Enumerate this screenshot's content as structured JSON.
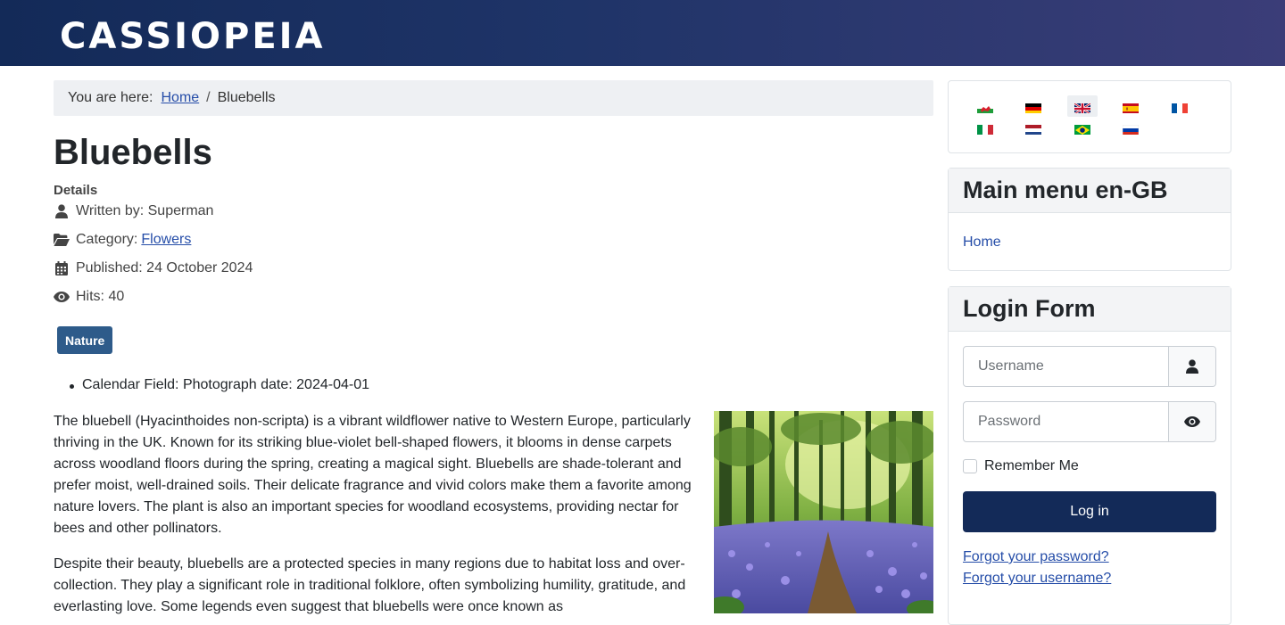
{
  "header": {
    "brand": "CASSIOPEIA"
  },
  "breadcrumb": {
    "prefix": "You are here:",
    "home": "Home",
    "separator": "/",
    "current": "Bluebells"
  },
  "article": {
    "title": "Bluebells",
    "details_label": "Details",
    "author": "Written by: Superman",
    "category_label": "Category:",
    "category_link": "Flowers",
    "published": "Published: 24 October 2024",
    "hits": "Hits: 40",
    "tag": "Nature",
    "custom_field": "Calendar Field: Photograph date: 2024-04-01",
    "paragraph1": "The bluebell (Hyacinthoides non-scripta) is a vibrant wildflower native to Western Europe, particularly thriving in the UK. Known for its striking blue-violet bell-shaped flowers, it blooms in dense carpets across woodland floors during the spring, creating a magical sight. Bluebells are shade-tolerant and prefer moist, well-drained soils. Their delicate fragrance and vivid colors make them a favorite among nature lovers. The plant is also an important species for woodland ecosystems, providing nectar for bees and other pollinators.",
    "paragraph2": "Despite their beauty, bluebells are a protected species in many regions due to habitat loss and over-collection. They play a significant role in traditional folklore, often symbolizing humility, gratitude, and everlasting love. Some legends even suggest that bluebells were once known as"
  },
  "languages": [
    {
      "name": "Welsh",
      "active": false
    },
    {
      "name": "German",
      "active": false
    },
    {
      "name": "English (UK)",
      "active": true
    },
    {
      "name": "Spanish",
      "active": false
    },
    {
      "name": "French",
      "active": false
    },
    {
      "name": "Italian",
      "active": false
    },
    {
      "name": "Dutch",
      "active": false
    },
    {
      "name": "Portuguese (Brazil)",
      "active": false
    },
    {
      "name": "Russian",
      "active": false
    }
  ],
  "main_menu": {
    "title": "Main menu en-GB",
    "items": [
      "Home"
    ]
  },
  "login": {
    "title": "Login Form",
    "username_placeholder": "Username",
    "password_placeholder": "Password",
    "remember_label": "Remember Me",
    "submit_label": "Log in",
    "forgot_password": "Forgot your password?",
    "forgot_username": "Forgot your username?"
  },
  "colors": {
    "header_start": "#132a58",
    "header_end": "#3b3d78",
    "link": "#254da8",
    "tag": "#2e5b8a",
    "button": "#132a58"
  }
}
